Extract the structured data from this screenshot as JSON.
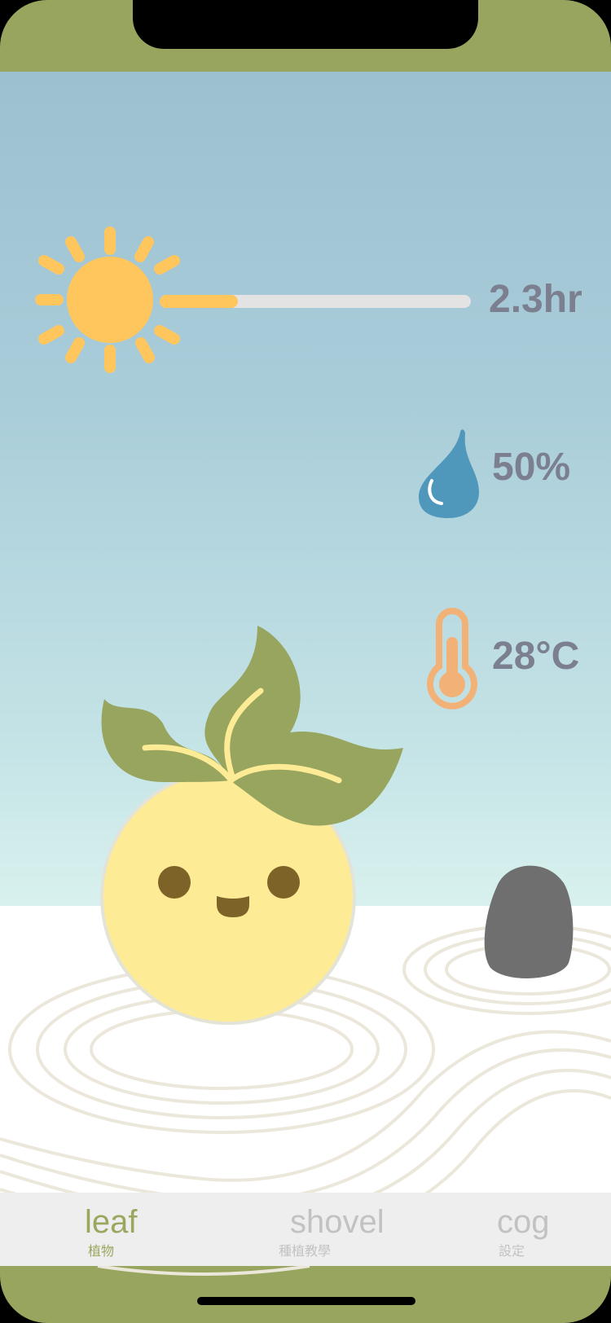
{
  "stats": {
    "sunlight": {
      "value": "2.3hr",
      "progress": 0.25,
      "icon": "sun-icon"
    },
    "humidity": {
      "value": "50%",
      "icon": "water-drop-icon"
    },
    "temperature": {
      "value": "28°C",
      "icon": "thermometer-icon"
    }
  },
  "tabs": [
    {
      "label": "leaf",
      "sub": "植物",
      "active": true
    },
    {
      "label": "shovel",
      "sub": "種植教學",
      "active": false
    },
    {
      "label": "cog",
      "sub": "設定",
      "active": false
    }
  ],
  "colors": {
    "frame": "#97a55e",
    "sun": "#ffc65e",
    "water": "#4f98bb",
    "thermometer": "#f2b277",
    "leaf": "#97a55e",
    "plant_body": "#feeb96",
    "stone": "#6f6f6f",
    "tab_active": "#9aa75f",
    "tab_inactive": "#c2c2c2"
  }
}
